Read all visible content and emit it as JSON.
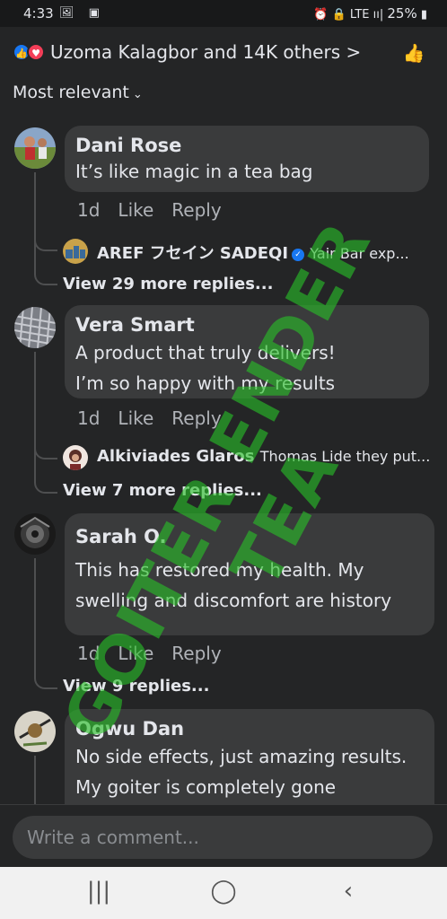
{
  "status_bar": {
    "time": "4:33",
    "left_icons": "🖼 ▣",
    "right_icons": "⏰ 🔒 LTE ıı| ",
    "battery": "25%"
  },
  "reactions": {
    "like_icon": "👍",
    "love_icon": "♥",
    "summary": "Uzoma Kalagbor and 14K others >",
    "like_page_icon": "👍"
  },
  "sort": {
    "label": "Most relevant",
    "chevron": "⌄"
  },
  "comments": [
    {
      "author": "Dani Rose",
      "lines": [
        "It’s like magic in a tea bag"
      ],
      "time": "1d",
      "like": "Like",
      "reply": "Reply",
      "reply_preview": {
        "name": "AREF フセイン SADEQI",
        "verified": "✓",
        "text": "Yair Bar exp..."
      },
      "view_more": "View 29 more replies..."
    },
    {
      "author": "Vera Smart",
      "lines": [
        "A product that truly delivers!",
        "I’m so happy with my results"
      ],
      "time": "1d",
      "like": "Like",
      "reply": "Reply",
      "reply_preview": {
        "name": "Alkiviades Glaros",
        "text": "Thomas Lide they put..."
      },
      "view_more": "View 7 more replies..."
    },
    {
      "author": "Sarah O.",
      "lines": [
        "This has restored my health. My",
        "swelling and discomfort are history"
      ],
      "time": "1d",
      "like": "Like",
      "reply": "Reply",
      "view_more": "View 9 replies..."
    },
    {
      "author": "Ogwu Dan",
      "lines": [
        "No side effects, just amazing results.",
        "My goiter is completely gone"
      ]
    }
  ],
  "composer": {
    "placeholder": "Write a comment..."
  },
  "nav": {
    "recent": "|||",
    "home": "◯",
    "back": "‹"
  },
  "watermark": "GOITER ENDER TEA",
  "colors": {
    "background": "#242526",
    "bubble": "#3a3b3c",
    "watermark": "#28be28",
    "like_blue": "#1877f2",
    "love_red": "#f33e58"
  }
}
